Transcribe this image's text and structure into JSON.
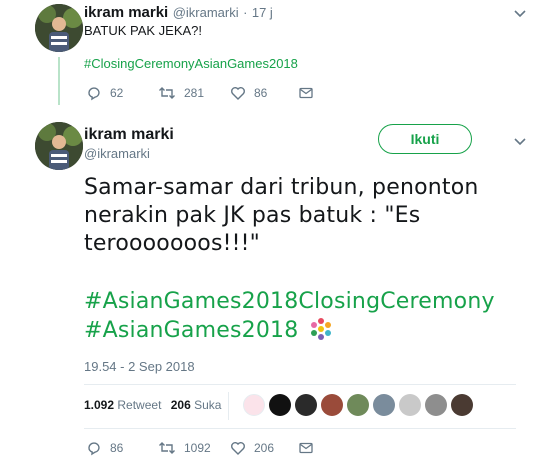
{
  "reply_tweet": {
    "name": "ikram marki",
    "handle": "@ikramarki",
    "separator": "·",
    "time": "17 j",
    "text": "BATUK PAK JEKA?!",
    "hashtag": "#ClosingCeremonyAsianGames2018",
    "actions": {
      "replies": "62",
      "retweets": "281",
      "likes": "86"
    }
  },
  "main_tweet": {
    "name": "ikram marki",
    "handle": "@ikramarki",
    "follow_label": "Ikuti",
    "text": "Samar-samar dari tribun, penonton nerakin pak JK pas batuk : \"Es terooooooos!!!\"",
    "hashtag1": "#AsianGames2018ClosingCeremony",
    "hashtag2": "#AsianGames2018",
    "timestamp": "19.54 - 2 Sep 2018",
    "stats": {
      "retweets_count": "1.092",
      "retweets_label": "Retweet",
      "likes_count": "206",
      "likes_label": "Suka"
    },
    "actions": {
      "replies": "86",
      "retweets": "1092",
      "likes": "206"
    }
  },
  "colors": {
    "accent": "#17a24a",
    "thread_line": "#b9e3c9",
    "muted": "#657786"
  }
}
